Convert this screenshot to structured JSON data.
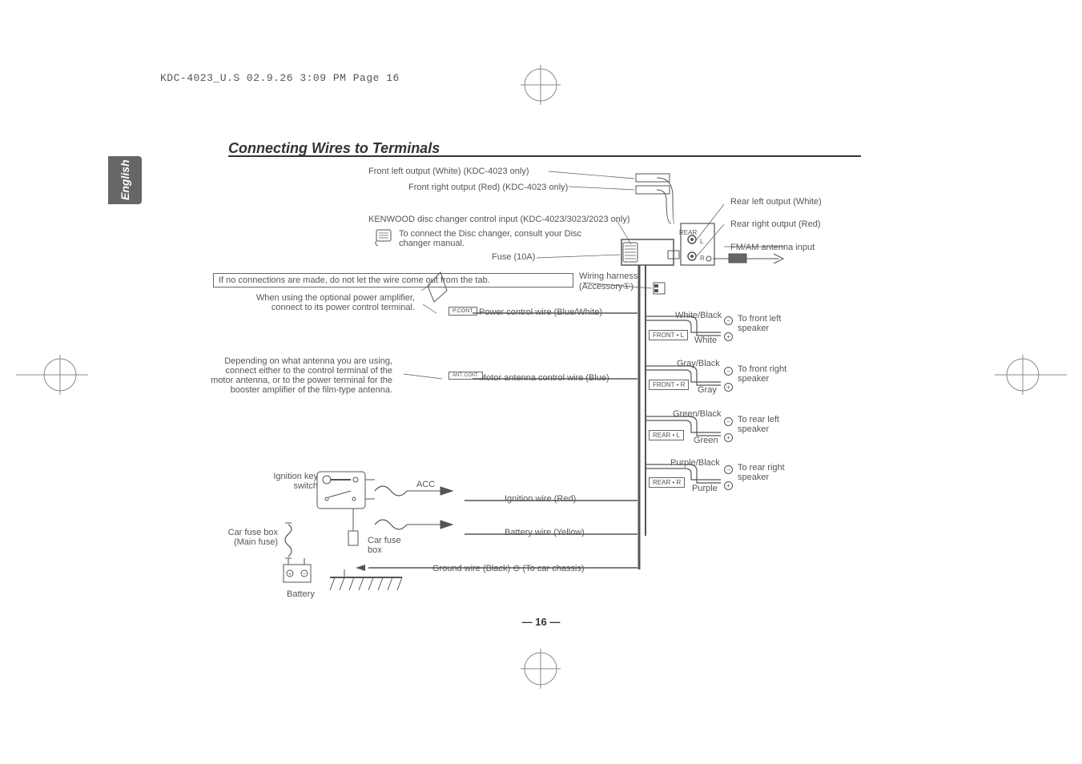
{
  "header_note": "KDC-4023_U.S  02.9.26  3:09 PM  Page 16",
  "language": "English",
  "title": "Connecting Wires to Terminals",
  "page_number": "— 16 —",
  "labels": {
    "front_left_output": "Front left output (White) (KDC-4023 only)",
    "front_right_output": "Front right output (Red) (KDC-4023 only)",
    "kenwood_input": "KENWOOD disc changer control input (KDC-4023/3023/2023 only)",
    "disc_changer_note": "To connect the Disc changer, consult your Disc changer manual.",
    "fuse_10a": "Fuse (10A)",
    "rear_left_output": "Rear left output (White)",
    "rear_right_output": "Rear right output (Red)",
    "fm_am_input": "FM/AM antenna input",
    "no_connections": "If no connections are made, do not let the wire come out from the tab.",
    "power_amp_note": "When using the optional power amplifier, connect to its power control terminal.",
    "power_control_wire": "Power control wire (Blue/White)",
    "antenna_note": "Depending on what antenna you are using, connect either to the control terminal of the motor antenna, or to the power terminal for the booster amplifier of the film-type antenna.",
    "motor_antenna_wire": "Motor antenna control wire (Blue)",
    "wiring_harness": "Wiring harness (Accessory①)",
    "ignition_key": "Ignition key switch",
    "acc": "ACC",
    "ignition_wire": "Ignition wire (Red)",
    "battery_wire": "Battery wire (Yellow)",
    "ground_wire": "Ground wire (Black) ⊖ (To car chassis)",
    "car_fuse_main": "Car fuse box (Main fuse)",
    "car_fuse_box": "Car fuse box",
    "battery": "Battery",
    "white_black": "White/Black",
    "white": "White",
    "gray_black": "Gray/Black",
    "gray": "Gray",
    "green_black": "Green/Black",
    "green": "Green",
    "purple_black": "Purple/Black",
    "purple": "Purple",
    "to_front_left": "To front left speaker",
    "to_front_right": "To front right speaker",
    "to_rear_left": "To rear left speaker",
    "to_rear_right": "To rear right speaker",
    "rear_tag": "REAR",
    "l_tag": "L",
    "r_tag": "R"
  },
  "wire_tags": {
    "pcont": "P.CONT",
    "ant_cont": "ANT. CONT.",
    "front_l": "FRONT • L",
    "front_r": "FRONT • R",
    "rear_l": "REAR • L",
    "rear_r": "REAR • R"
  }
}
